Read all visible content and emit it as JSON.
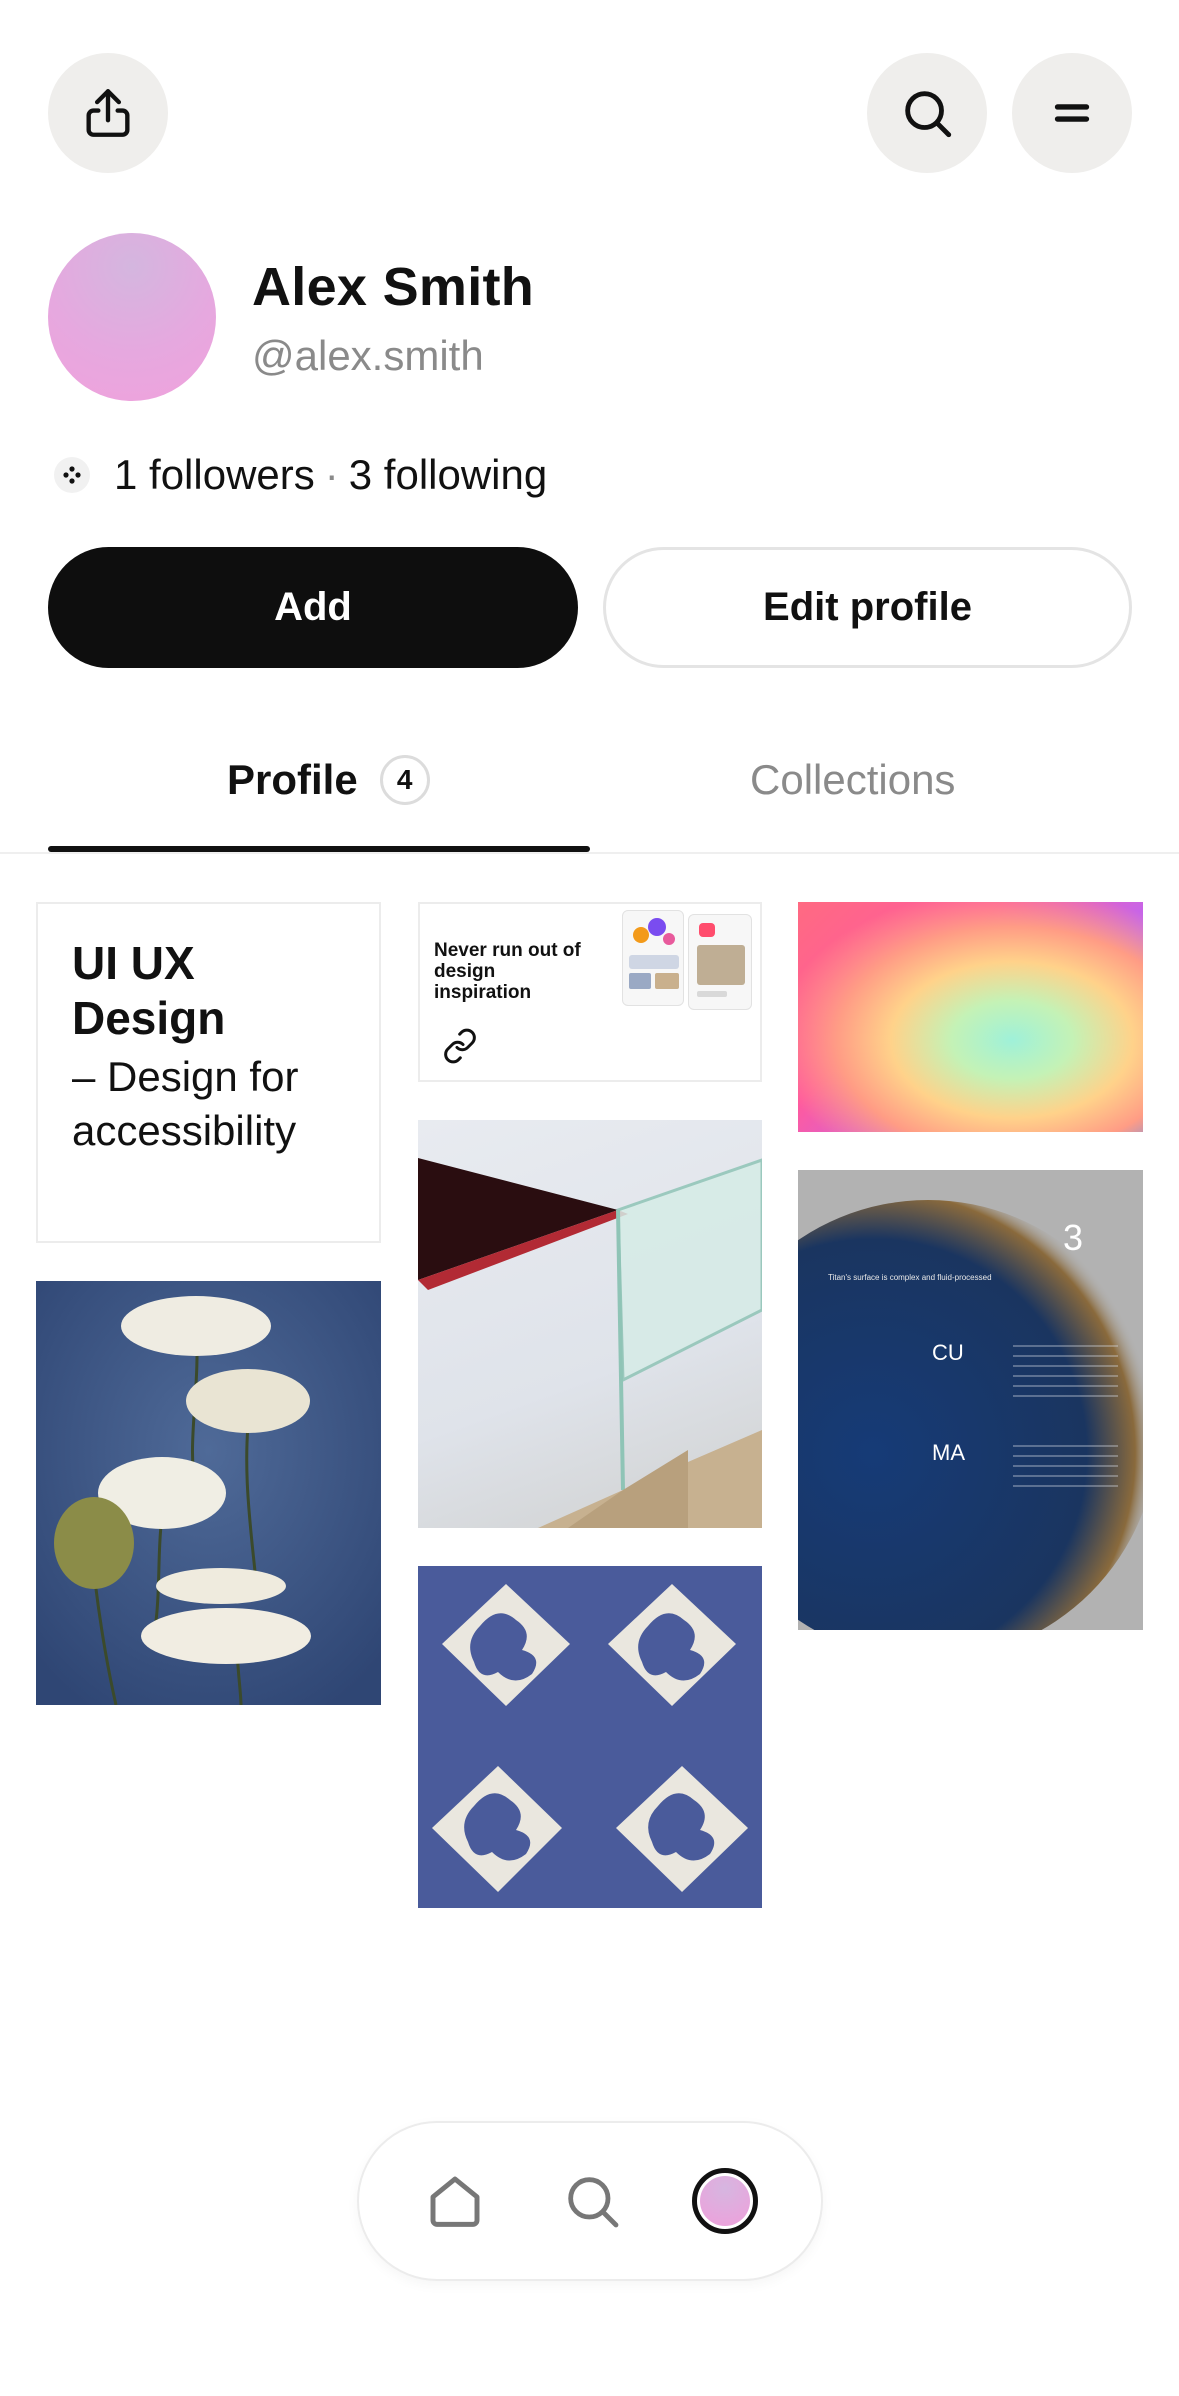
{
  "header": {
    "share_icon": "share-icon",
    "search_icon": "search-icon",
    "menu_icon": "menu-icon"
  },
  "profile": {
    "name": "Alex Smith",
    "handle": "@alex.smith",
    "followers_text": "1 followers",
    "separator": "·",
    "following_text": "3 following"
  },
  "actions": {
    "add_label": "Add",
    "edit_label": "Edit profile"
  },
  "tabs": {
    "profile_label": "Profile",
    "profile_count": "4",
    "collections_label": "Collections"
  },
  "cards": {
    "text_card_title": "UI UX Design",
    "text_card_subtitle": "– Design for accessibility",
    "link_card_text": "Never run out of design inspiration",
    "cuma_number": "3",
    "cuma_caption": "Titan's surface is complex and fluid-processed",
    "cuma_line1": "CU",
    "cuma_line2": "MA"
  },
  "nav": {
    "home_icon": "home-icon",
    "search_icon": "search-icon",
    "profile_icon": "avatar"
  },
  "colors": {
    "primary_button": "#0e0e0e",
    "muted_text": "#8a8a8a",
    "icon_button_bg": "#efeeec"
  }
}
